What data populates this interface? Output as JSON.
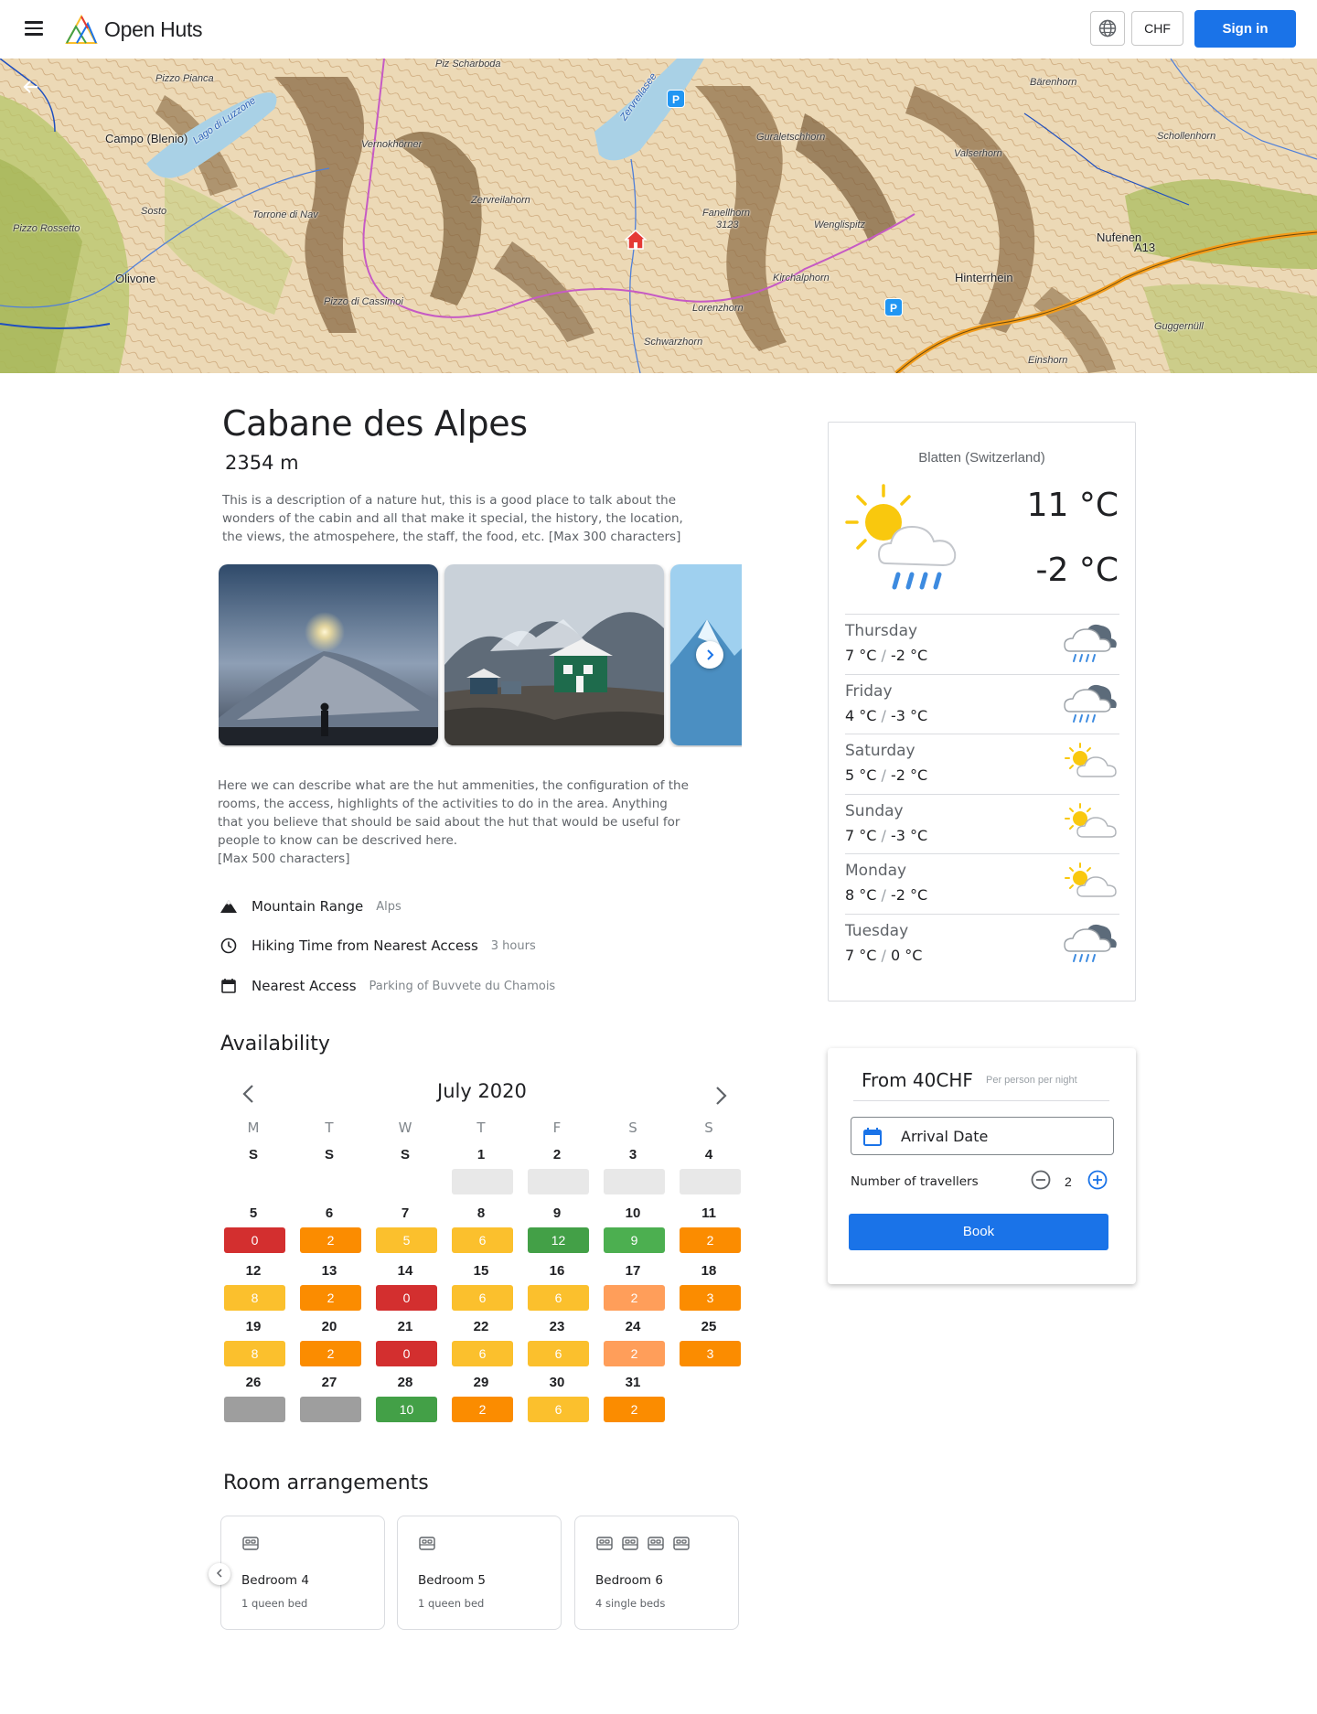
{
  "header": {
    "brand": "Open Huts",
    "currency": "CHF",
    "signin_label": "Sign in"
  },
  "map": {
    "labels": [
      "Piz Scharboda",
      "Pizzo Pianca",
      "Lago di Luzzone",
      "Zervreilasee",
      "Bärenhorn",
      "Campo (Blenio)",
      "Vernokhörner",
      "Guraletschhorn",
      "Schollenhorn",
      "Valserhorn",
      "Sosto",
      "Zervreilahorn",
      "Torrone di Nav",
      "Fanellhorn",
      "3123",
      "Wenglispitz",
      "Nufenen",
      "Pizzo Rossetto",
      "A13",
      "Olivone",
      "Kirchalphorn",
      "Hinterrhein",
      "Pizzo di Cassimoi",
      "Lorenzhorn",
      "Guggernüll",
      "Schwarzhorn",
      "Einshorn"
    ],
    "parking_label": "P"
  },
  "hut": {
    "name": "Cabane des Alpes",
    "altitude": "2354 m",
    "description": "This is a description of a nature hut, this is a good place to talk about the wonders of the cabin and all that make it special, the history, the location, the views, the atmospehere, the staff, the food, etc. [Max 300 characters]",
    "amenities_line1": "Here we can  describe what are the hut ammenities, the configuration of the rooms, the access, highlights of the activities to do in the area. Anything that you believe that should be said about the hut that would be useful for people to know can be descrived here.",
    "amenities_line2": "[Max 500 characters]",
    "next_icon": "chevron-right-icon"
  },
  "info": [
    {
      "label": "Mountain Range",
      "value": "Alps",
      "icon": "mountain-icon"
    },
    {
      "label": "Hiking Time from Nearest Access",
      "value": "3 hours",
      "icon": "clock-icon"
    },
    {
      "label": "Nearest Access",
      "value": "Parking of Buvvete du Chamois",
      "icon": "calendar-icon"
    }
  ],
  "availability": {
    "title": "Availability",
    "month": "July 2020",
    "dow": [
      "M",
      "T",
      "W",
      "T",
      "F",
      "S",
      "S"
    ],
    "weeks": [
      [
        {
          "d": "S"
        },
        {
          "d": "S"
        },
        {
          "d": "S"
        },
        {
          "d": "1",
          "v": "",
          "c": "#e8e8e8"
        },
        {
          "d": "2",
          "v": "",
          "c": "#e8e8e8"
        },
        {
          "d": "3",
          "v": "",
          "c": "#e8e8e8"
        },
        {
          "d": "4",
          "v": "",
          "c": "#e8e8e8"
        }
      ],
      [
        {
          "d": "5",
          "v": "0",
          "c": "#d32f2f"
        },
        {
          "d": "6",
          "v": "2",
          "c": "#fb8c00"
        },
        {
          "d": "7",
          "v": "5",
          "c": "#fbc02d"
        },
        {
          "d": "8",
          "v": "6",
          "c": "#fbc02d"
        },
        {
          "d": "9",
          "v": "12",
          "c": "#43a047"
        },
        {
          "d": "10",
          "v": "9",
          "c": "#4caf50"
        },
        {
          "d": "11",
          "v": "2",
          "c": "#fb8c00"
        }
      ],
      [
        {
          "d": "12",
          "v": "8",
          "c": "#fbc02d"
        },
        {
          "d": "13",
          "v": "2",
          "c": "#fb8c00"
        },
        {
          "d": "14",
          "v": "0",
          "c": "#d32f2f"
        },
        {
          "d": "15",
          "v": "6",
          "c": "#fbc02d"
        },
        {
          "d": "16",
          "v": "6",
          "c": "#fbc02d"
        },
        {
          "d": "17",
          "v": "2",
          "c": "#ff9e5a"
        },
        {
          "d": "18",
          "v": "3",
          "c": "#fb8c00"
        }
      ],
      [
        {
          "d": "19",
          "v": "8",
          "c": "#fbc02d"
        },
        {
          "d": "20",
          "v": "2",
          "c": "#fb8c00"
        },
        {
          "d": "21",
          "v": "0",
          "c": "#d32f2f"
        },
        {
          "d": "22",
          "v": "6",
          "c": "#fbc02d"
        },
        {
          "d": "23",
          "v": "6",
          "c": "#fbc02d"
        },
        {
          "d": "24",
          "v": "2",
          "c": "#ff9e5a"
        },
        {
          "d": "25",
          "v": "3",
          "c": "#fb8c00"
        }
      ],
      [
        {
          "d": "26",
          "v": "",
          "c": "#9e9e9e"
        },
        {
          "d": "27",
          "v": "",
          "c": "#9e9e9e"
        },
        {
          "d": "28",
          "v": "10",
          "c": "#43a047"
        },
        {
          "d": "29",
          "v": "2",
          "c": "#fb8c00"
        },
        {
          "d": "30",
          "v": "6",
          "c": "#fbc02d"
        },
        {
          "d": "31",
          "v": "2",
          "c": "#fb8c00"
        }
      ]
    ]
  },
  "rooms": {
    "title": "Room arrangements",
    "items": [
      {
        "name": "Bedroom 4",
        "beds": "1 queen bed",
        "bed_count": 1
      },
      {
        "name": "Bedroom 5",
        "beds": "1 queen bed",
        "bed_count": 1
      },
      {
        "name": "Bedroom 6",
        "beds": "4 single beds",
        "bed_count": 4
      }
    ]
  },
  "weather": {
    "location": "Blatten (Switzerland)",
    "today_max": "11 °C",
    "today_min": "-2 °C",
    "today_icon": "sun-cloud-rain-icon",
    "days": [
      {
        "day": "Thursday",
        "max": "7 °C",
        "min": "-2 °C",
        "icon": "cloud-rain-icon"
      },
      {
        "day": "Friday",
        "max": "4 °C",
        "min": "-3 °C",
        "icon": "cloud-rain-icon"
      },
      {
        "day": "Saturday",
        "max": "5 °C",
        "min": "-2 °C",
        "icon": "sun-cloud-icon"
      },
      {
        "day": "Sunday",
        "max": "7 °C",
        "min": "-3 °C",
        "icon": "sun-cloud-icon"
      },
      {
        "day": "Monday",
        "max": "8 °C",
        "min": "-2 °C",
        "icon": "sun-cloud-icon"
      },
      {
        "day": "Tuesday",
        "max": "7 °C",
        "min": "0 °C",
        "icon": "cloud-rain-icon"
      }
    ],
    "separator": "/"
  },
  "booking": {
    "price": "From 40CHF",
    "unit": "Per person per night",
    "arrival_label": "Arrival Date",
    "travellers_label": "Number of travellers",
    "travellers": "2",
    "book_label": "Book"
  },
  "colors": {
    "accent": "#1a73e8",
    "red": "#d32f2f",
    "orange": "#fb8c00",
    "yellow": "#fbc02d",
    "green": "#43a047",
    "grey": "#9e9e9e"
  }
}
